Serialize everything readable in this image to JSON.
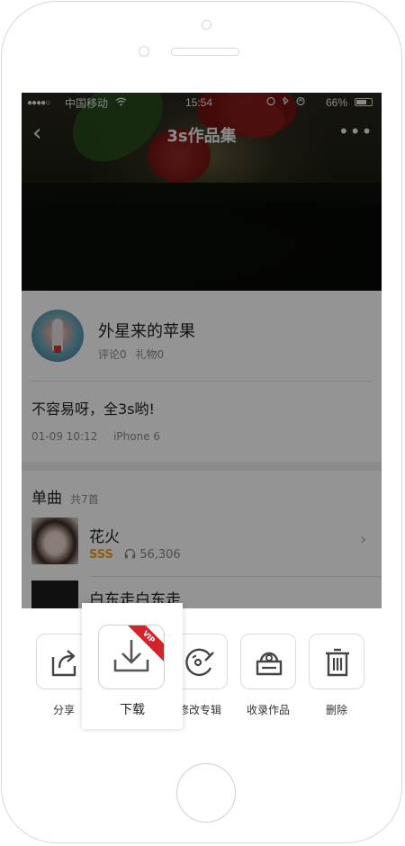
{
  "status_bar": {
    "signal_dots": "●●●●○",
    "carrier": "中国移动",
    "wifi_icon": "wifi-icon",
    "time": "15:54",
    "battery": "66%",
    "battery_level": 0.66
  },
  "nav": {
    "title": "3s作品集",
    "back_icon": "chevron-left-icon",
    "more_icon": "more-dots-icon",
    "back_glyph": "‹",
    "more_glyph": "•••"
  },
  "author": {
    "name": "外星来的苹果",
    "comments": "评论0",
    "gifts": "礼物0"
  },
  "post": {
    "text": "不容易呀，全3s哟!",
    "time": "01-09 10:12",
    "device": "iPhone 6"
  },
  "songs": {
    "title": "单曲",
    "count": "共7首",
    "items": [
      {
        "title": "花火",
        "grade": "SSS",
        "plays": "56,306"
      },
      {
        "title": "白东走白东走"
      }
    ]
  },
  "actions": {
    "share": "分享",
    "download": "下载",
    "download_badge": "VIP",
    "edit_album": "修改专辑",
    "collect": "收录作品",
    "delete": "删除"
  },
  "colors": {
    "accent": "#d3222a",
    "grade": "#f0a020"
  }
}
